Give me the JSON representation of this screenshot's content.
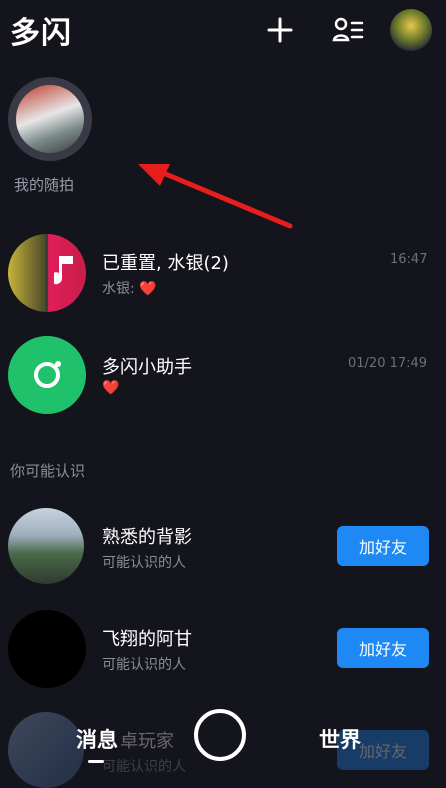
{
  "header": {
    "title": "多闪"
  },
  "story": {
    "label": "我的随拍"
  },
  "conversations": [
    {
      "name": "已重置, 水银(2)",
      "preview": "水银: ❤️",
      "time": "16:47"
    },
    {
      "name": "多闪小助手",
      "preview": "❤️",
      "time": "01/20 17:49"
    }
  ],
  "suggest": {
    "title": "你可能认识",
    "items": [
      {
        "name": "熟悉的背影",
        "sub": "可能认识的人",
        "button": "加好友"
      },
      {
        "name": "飞翔的阿甘",
        "sub": "可能认识的人",
        "button": "加好友"
      },
      {
        "name": "卓玩家",
        "sub": "可能认识的人",
        "button": "加好友"
      }
    ]
  },
  "tabs": {
    "left": "消息",
    "right": "世界"
  },
  "colors": {
    "background": "#14141c",
    "accent": "#1e88f5",
    "assistant": "#1fc16b",
    "arrow": "#e81e1e"
  }
}
